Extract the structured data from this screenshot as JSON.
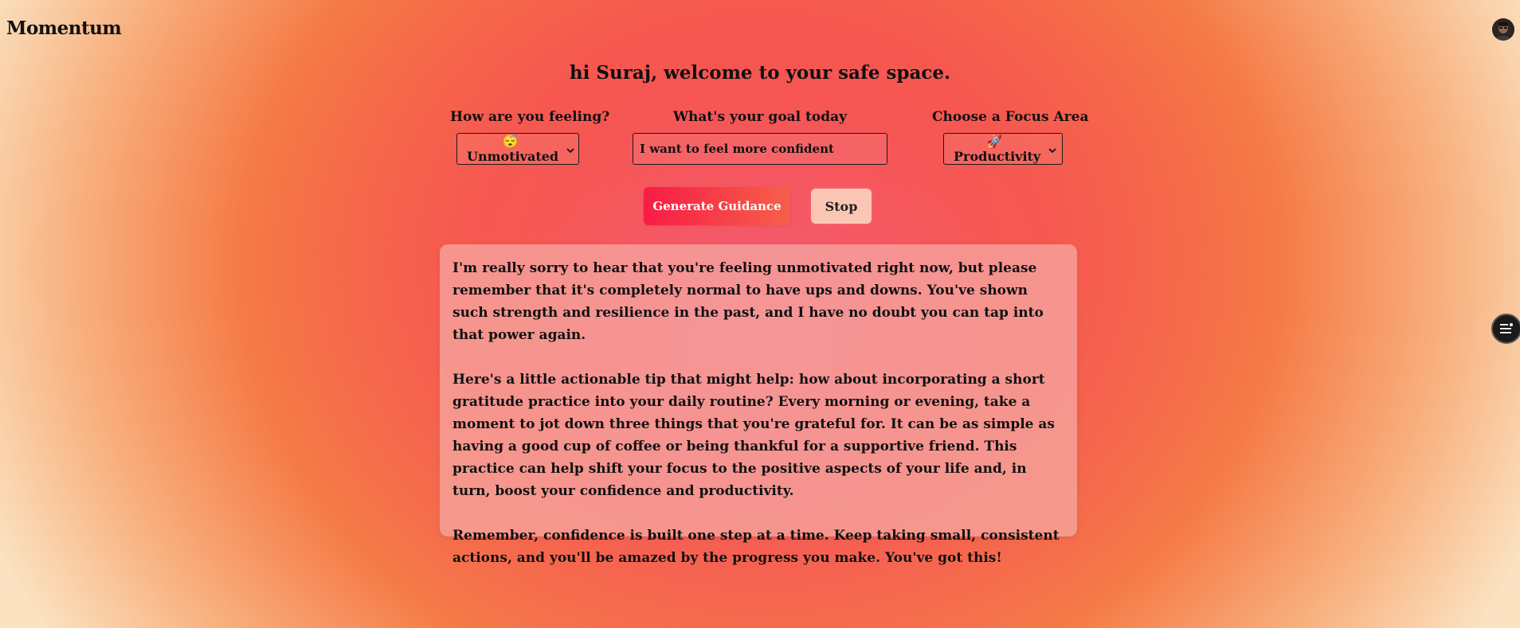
{
  "app": {
    "title": "Momentum"
  },
  "header": {
    "avatar_icon": "user-avatar"
  },
  "welcome": {
    "text": "hi Suraj, welcome to your safe space."
  },
  "mood": {
    "label": "How are you feeling?",
    "selected_emoji": "😴",
    "selected_text": "Unmotivated"
  },
  "goal": {
    "label": "What's your goal today",
    "value": "I want to feel more confident"
  },
  "focus": {
    "label": "Choose a Focus Area",
    "selected_emoji": "🚀",
    "selected_text": "Productivity"
  },
  "actions": {
    "generate_label": "Generate Guidance",
    "stop_label": "Stop"
  },
  "output": {
    "paragraphs": [
      "I'm really sorry to hear that you're feeling unmotivated right now, but please remember that it's completely normal to have ups and downs. You've shown such strength and resilience in the past, and I have no doubt you can tap into that power again.",
      "Here's a little actionable tip that might help: how about incorporating a short gratitude practice into your daily routine? Every morning or evening, take a moment to jot down three things that you're grateful for. It can be as simple as having a good cup of coffee or being thankful for a supportive friend. This practice can help shift your focus to the positive aspects of your life and, in turn, boost your confidence and productivity.",
      "Remember, confidence is built one step at a time. Keep taking small, consistent actions, and you'll be amazed by the progress you make. You've got this!"
    ]
  },
  "colors": {
    "accent_red": "#f81c45",
    "accent_orange": "#f5604a",
    "stop_bg": "#fbc7b4"
  },
  "icons": {
    "side_toggle": "menu-list-icon",
    "chevron": "chevron-down-icon"
  }
}
